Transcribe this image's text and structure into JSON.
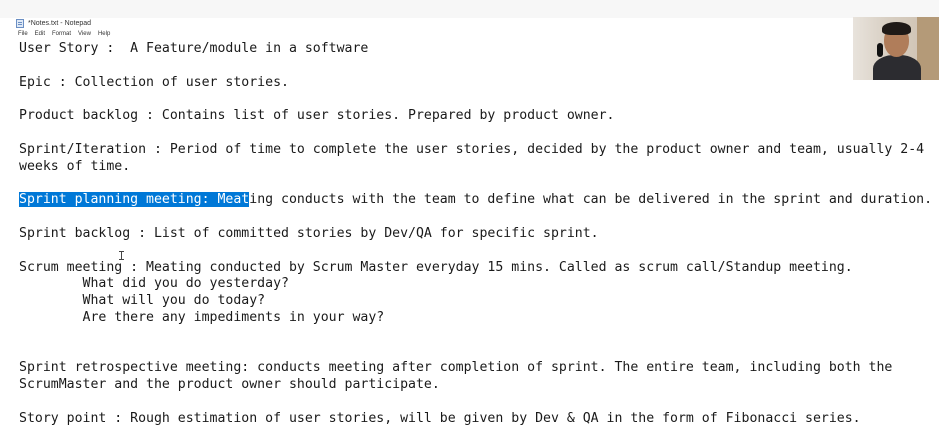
{
  "window": {
    "title": "*Notes.txt - Notepad"
  },
  "menubar": {
    "items": [
      "File",
      "Edit",
      "Format",
      "View",
      "Help"
    ]
  },
  "editor": {
    "selection": "Sprint planning meeting: Meat",
    "lines": [
      "User Story :  A Feature/module in a software",
      "",
      "Epic : Collection of user stories.",
      "",
      "Product backlog : Contains list of user stories. Prepared by product owner.",
      "",
      "Sprint/Iteration : Period of time to complete the user stories, decided by the product owner and team, usually 2-4",
      "weeks of time.",
      "",
      "Sprint planning meeting: Meating conducts with the team to define what can be delivered in the sprint and duration.",
      "",
      "Sprint backlog : List of committed stories by Dev/QA for specific sprint.",
      "",
      "Scrum meeting : Meating conducted by Scrum Master everyday 15 mins. Called as scrum call/Standup meeting.",
      "        What did you do yesterday?",
      "        What will you do today?",
      "        Are there any impediments in your way?",
      "",
      "",
      "Sprint retrospective meeting: conducts meeting after completion of sprint. The entire team, including both the",
      "ScrumMaster and the product owner should participate.",
      "",
      "Story point : Rough estimation of user stories, will be given by Dev & QA in the form of Fibonacci series."
    ],
    "line9_rest": "ing conducts with the team to define what can be delivered in the sprint and duration."
  }
}
